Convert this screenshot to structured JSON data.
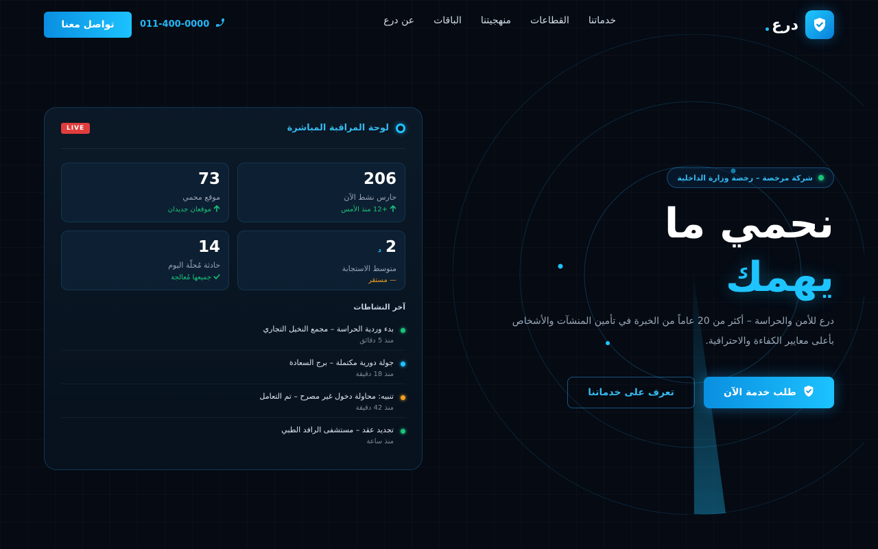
{
  "brand": {
    "name": "درع"
  },
  "nav": {
    "items": [
      {
        "label": "خدماتنا"
      },
      {
        "label": "القطاعات"
      },
      {
        "label": "منهجيتنا"
      },
      {
        "label": "الباقات"
      },
      {
        "label": "عن درع"
      }
    ]
  },
  "header": {
    "phone": "011-400-0000",
    "contact_label": "تواصل معنا"
  },
  "hero": {
    "badge": "شركة مرخصة – رخصة وزارة الداخلية",
    "title_line1": "نحمي ما",
    "title_line2": "يهمك",
    "description": "درع للأمن والحراسة – أكثر من 20 عاماً من الخبرة في تأمين المنشآت والأشخاص بأعلى معايير الكفاءة والاحترافية.",
    "primary_cta": "طلب خدمة الآن",
    "secondary_cta": "تعرف على خدماتنا"
  },
  "dashboard": {
    "title": "لوحة المراقبة المباشرة",
    "live_label": "LIVE",
    "stats": [
      {
        "value": "206",
        "unit": "",
        "label": "حارس نشط الآن",
        "trend": "+12 منذ الأمس",
        "trend_icon": "arrow-up-icon"
      },
      {
        "value": "73",
        "unit": "",
        "label": "موقع محمي",
        "trend": "موقعان جديدان",
        "trend_icon": "arrow-up-icon"
      },
      {
        "value": "2",
        "unit": "د",
        "label": "متوسط الاستجابة",
        "trend": "— مستقر",
        "trend_icon": ""
      },
      {
        "value": "14",
        "unit": "",
        "label": "حادثة مُحلّة اليوم",
        "trend": "جميعها مُعالجة",
        "trend_icon": "check-icon"
      }
    ],
    "activity_title": "آخر النشاطات",
    "activities": [
      {
        "text": "بدء وردية الحراسة – مجمع النخيل التجاري",
        "time": "منذ 5 دقائق",
        "color": "#19c47a"
      },
      {
        "text": "جولة دورية مكتملة – برج السعادة",
        "time": "منذ 18 دقيقة",
        "color": "#1ec4ff"
      },
      {
        "text": "تنبيه: محاولة دخول غير مصرح – تم التعامل",
        "time": "منذ 42 دقيقة",
        "color": "#f0a020"
      },
      {
        "text": "تجديد عقد – مستشفى الرافد الطبي",
        "time": "منذ ساعة",
        "color": "#19c47a"
      }
    ]
  },
  "colors": {
    "accent": "#1ec4ff",
    "background": "#050a13",
    "success": "#19c47a",
    "warning": "#f0a020",
    "danger": "#e03d3d"
  }
}
